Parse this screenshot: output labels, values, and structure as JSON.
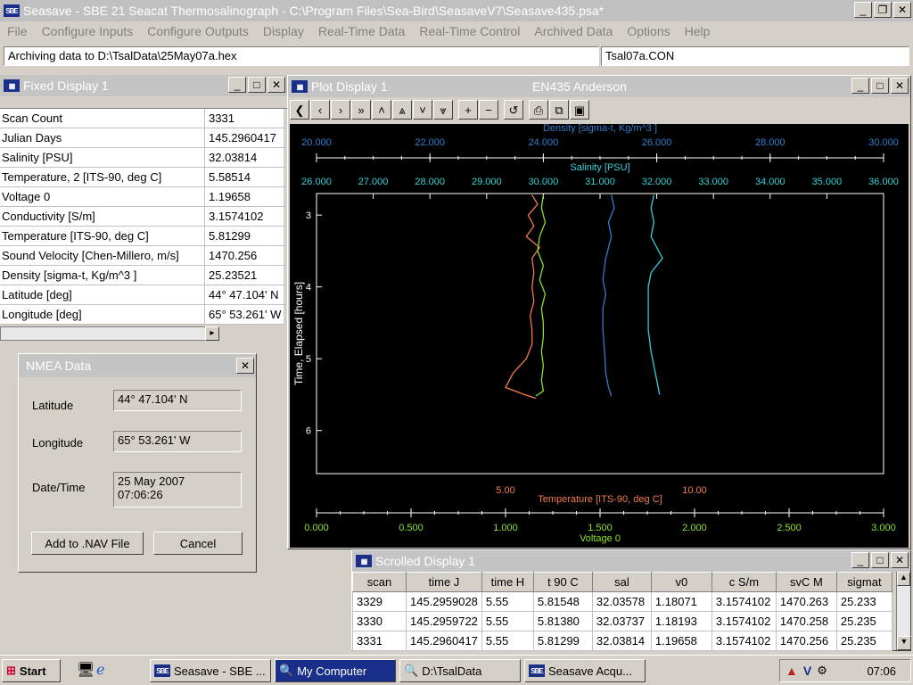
{
  "app": {
    "title": "Seasave - SBE 21 Seacat Thermosalinograph - C:\\Program Files\\Sea-Bird\\SeasaveV7\\Seasave435.psa*"
  },
  "menu": [
    "File",
    "Configure Inputs",
    "Configure Outputs",
    "Display",
    "Real-Time Data",
    "Real-Time Control",
    "Archived Data",
    "Options",
    "Help"
  ],
  "status": {
    "archive": "Archiving data to D:\\TsalData\\25May07a.hex",
    "config": "Tsal07a.CON"
  },
  "fixed_display": {
    "title": "Fixed Display 1",
    "rows": [
      {
        "label": "Scan Count",
        "value": "3331"
      },
      {
        "label": "Julian Days",
        "value": "145.2960417"
      },
      {
        "label": "Salinity [PSU]",
        "value": "32.03814"
      },
      {
        "label": "Temperature, 2 [ITS-90, deg C]",
        "value": "5.58514"
      },
      {
        "label": "Voltage 0",
        "value": "1.19658"
      },
      {
        "label": "Conductivity [S/m]",
        "value": "3.1574102"
      },
      {
        "label": "Temperature [ITS-90, deg C]",
        "value": "5.81299"
      },
      {
        "label": "Sound Velocity [Chen-Millero, m/s]",
        "value": "1470.256"
      },
      {
        "label": "Density [sigma-t, Kg/m^3 ]",
        "value": "25.23521"
      },
      {
        "label": "Latitude [deg]",
        "value": " 44° 47.104' N"
      },
      {
        "label": "Longitude [deg]",
        "value": " 65° 53.261' W"
      }
    ]
  },
  "nmea": {
    "title": "NMEA Data",
    "lat_label": "Latitude",
    "lat_value": "44° 47.104' N",
    "lon_label": "Longitude",
    "lon_value": "65° 53.261' W",
    "dt_label": "Date/Time",
    "date_value": "25 May 2007",
    "time_value": "07:06:26",
    "add_button": "Add to .NAV File",
    "cancel_button": "Cancel"
  },
  "plot": {
    "title": "Plot Display 1",
    "subtitle": "EN435 Anderson",
    "toolbar_icons": [
      "first-icon",
      "prev-icon",
      "next-icon",
      "last-icon",
      "up-icon",
      "top-icon",
      "down-icon",
      "bottom-icon",
      "zoom-in-icon",
      "zoom-out-icon",
      "reset-icon",
      "print-icon",
      "copy-icon",
      "save-icon"
    ]
  },
  "chart_data": {
    "type": "line",
    "y_axis": {
      "label": "Time, Elapsed [hours]",
      "range": [
        2.7,
        6.6
      ],
      "ticks": [
        3,
        4,
        5,
        6
      ]
    },
    "axes": [
      {
        "name": "Density [sigma-t, Kg/m^3 ]",
        "position": "top-1",
        "range": [
          20,
          30
        ],
        "ticks": [
          "20.000",
          "22.000",
          "24.000",
          "26.000",
          "28.000",
          "30.000"
        ],
        "color": "#2e7fd0"
      },
      {
        "name": "Salinity [PSU]",
        "position": "top-2",
        "range": [
          26,
          36
        ],
        "ticks": [
          "26.000",
          "27.000",
          "28.000",
          "29.000",
          "30.000",
          "31.000",
          "32.000",
          "33.000",
          "34.000",
          "35.000",
          "36.000"
        ],
        "color": "#33d0d8"
      },
      {
        "name": "Temperature [ITS-90, deg C]",
        "position": "bottom-1",
        "range": [
          0,
          15
        ],
        "ticks": [
          "5.00",
          "10.00"
        ],
        "color": "#f47c4a"
      },
      {
        "name": "Voltage 0",
        "position": "bottom-2",
        "range": [
          0,
          3
        ],
        "ticks": [
          "0.000",
          "0.500",
          "1.000",
          "1.500",
          "2.000",
          "2.500",
          "3.000"
        ],
        "color": "#8ee02a"
      }
    ],
    "series": [
      {
        "name": "Temperature [ITS-90, deg C]",
        "axis": 2,
        "color": "#f47c4a",
        "points": [
          [
            5.7,
            2.72
          ],
          [
            5.85,
            2.85
          ],
          [
            5.6,
            3.0
          ],
          [
            5.75,
            3.15
          ],
          [
            5.55,
            3.3
          ],
          [
            5.9,
            3.45
          ],
          [
            5.7,
            3.6
          ],
          [
            5.75,
            3.8
          ],
          [
            5.7,
            4.0
          ],
          [
            5.75,
            4.2
          ],
          [
            5.65,
            4.4
          ],
          [
            5.7,
            4.6
          ],
          [
            5.7,
            4.8
          ],
          [
            5.55,
            5.0
          ],
          [
            5.2,
            5.2
          ],
          [
            5.0,
            5.4
          ],
          [
            5.5,
            5.5
          ],
          [
            5.8,
            5.55
          ]
        ]
      },
      {
        "name": "Voltage 0",
        "axis": 3,
        "color": "#8ee02a",
        "points": [
          [
            1.2,
            2.72
          ],
          [
            1.19,
            2.9
          ],
          [
            1.21,
            3.1
          ],
          [
            1.18,
            3.3
          ],
          [
            1.17,
            3.5
          ],
          [
            1.2,
            3.7
          ],
          [
            1.18,
            3.9
          ],
          [
            1.21,
            4.1
          ],
          [
            1.19,
            4.3
          ],
          [
            1.2,
            4.5
          ],
          [
            1.2,
            4.7
          ],
          [
            1.19,
            4.9
          ],
          [
            1.2,
            5.1
          ],
          [
            1.19,
            5.3
          ],
          [
            1.2,
            5.45
          ],
          [
            1.16,
            5.52
          ]
        ]
      },
      {
        "name": "Density [sigma-t, Kg/m^3 ]",
        "axis": 0,
        "color": "#2e7fd0",
        "points": [
          [
            25.2,
            2.72
          ],
          [
            25.25,
            2.9
          ],
          [
            25.15,
            3.1
          ],
          [
            25.2,
            3.3
          ],
          [
            25.1,
            3.6
          ],
          [
            25.05,
            3.9
          ],
          [
            25.1,
            4.1
          ],
          [
            25.05,
            4.3
          ],
          [
            25.05,
            4.6
          ],
          [
            25.08,
            4.9
          ],
          [
            25.1,
            5.2
          ],
          [
            25.15,
            5.4
          ],
          [
            25.2,
            5.52
          ]
        ]
      },
      {
        "name": "Salinity [PSU]",
        "axis": 1,
        "color": "#33d0d8",
        "points": [
          [
            31.95,
            2.72
          ],
          [
            31.9,
            2.9
          ],
          [
            31.95,
            3.1
          ],
          [
            31.9,
            3.3
          ],
          [
            32.1,
            3.6
          ],
          [
            31.9,
            3.8
          ],
          [
            31.85,
            4.0
          ],
          [
            31.85,
            4.3
          ],
          [
            31.85,
            4.6
          ],
          [
            31.9,
            4.9
          ],
          [
            31.95,
            5.1
          ],
          [
            32.0,
            5.3
          ],
          [
            32.05,
            5.5
          ]
        ]
      }
    ]
  },
  "scrolled": {
    "title": "Scrolled Display 1",
    "headers": [
      "scan",
      "time J",
      "time H",
      "t 90 C",
      "sal",
      "v0",
      "c S/m",
      "svC M",
      "sigmat"
    ],
    "rows": [
      [
        "3329",
        "145.2959028",
        "5.55",
        "5.81548",
        "32.03578",
        "1.18071",
        "3.1574102",
        "1470.263",
        "25.233"
      ],
      [
        "3330",
        "145.2959722",
        "5.55",
        "5.81380",
        "32.03737",
        "1.18193",
        "3.1574102",
        "1470.258",
        "25.235"
      ],
      [
        "3331",
        "145.2960417",
        "5.55",
        "5.81299",
        "32.03814",
        "1.19658",
        "3.1574102",
        "1470.256",
        "25.235"
      ]
    ]
  },
  "taskbar": {
    "start": "Start",
    "items": [
      "Seasave - SBE ...",
      "My Computer",
      "D:\\TsalData",
      "Seasave Acqu..."
    ],
    "clock": "07:06"
  }
}
